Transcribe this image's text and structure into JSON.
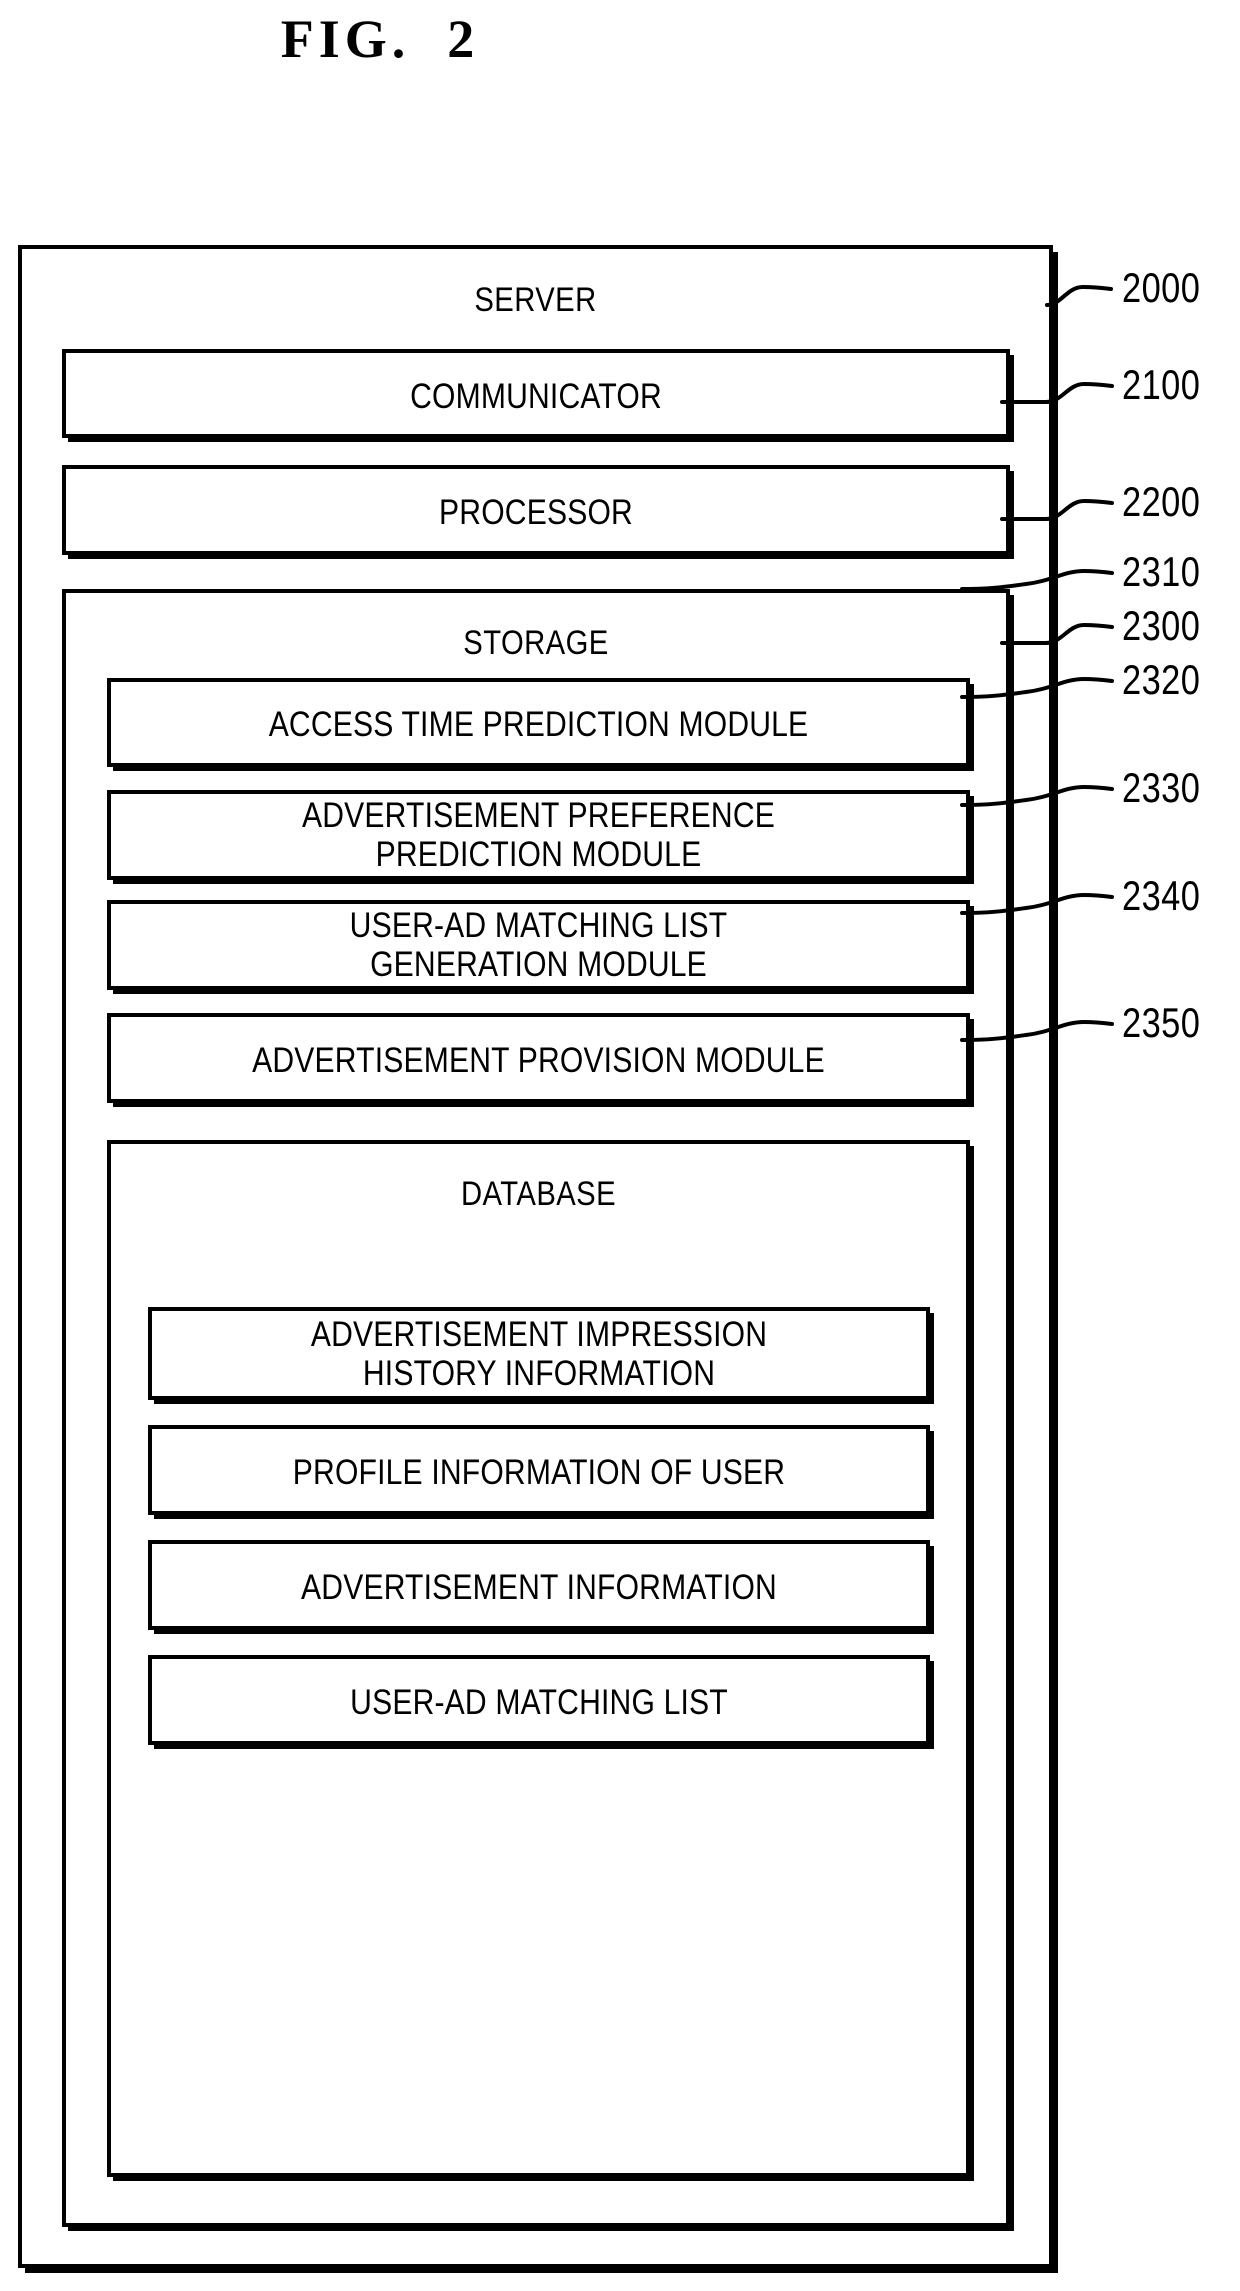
{
  "figure": {
    "title": "FIG.  2"
  },
  "server": {
    "label": "SERVER",
    "ref": "2000",
    "communicator": {
      "label": "COMMUNICATOR",
      "ref": "2100"
    },
    "processor": {
      "label": "PROCESSOR",
      "ref": "2200"
    },
    "storage": {
      "label": "STORAGE",
      "ref": "2300",
      "modules": [
        {
          "label": "ACCESS TIME PREDICTION MODULE",
          "ref": "2310"
        },
        {
          "label": "ADVERTISEMENT PREFERENCE\nPREDICTION MODULE",
          "ref": "2320"
        },
        {
          "label": "USER-AD MATCHING LIST\nGENERATION MODULE",
          "ref": "2330"
        },
        {
          "label": "ADVERTISEMENT PROVISION MODULE",
          "ref": "2340"
        }
      ],
      "database": {
        "label": "DATABASE",
        "ref": "2350",
        "items": [
          {
            "label": "ADVERTISEMENT IMPRESSION\nHISTORY INFORMATION"
          },
          {
            "label": "PROFILE INFORMATION OF USER"
          },
          {
            "label": "ADVERTISEMENT INFORMATION"
          },
          {
            "label": "USER-AD MATCHING LIST"
          }
        ]
      }
    }
  },
  "colors": {
    "line": "#000000",
    "background": "#ffffff"
  }
}
